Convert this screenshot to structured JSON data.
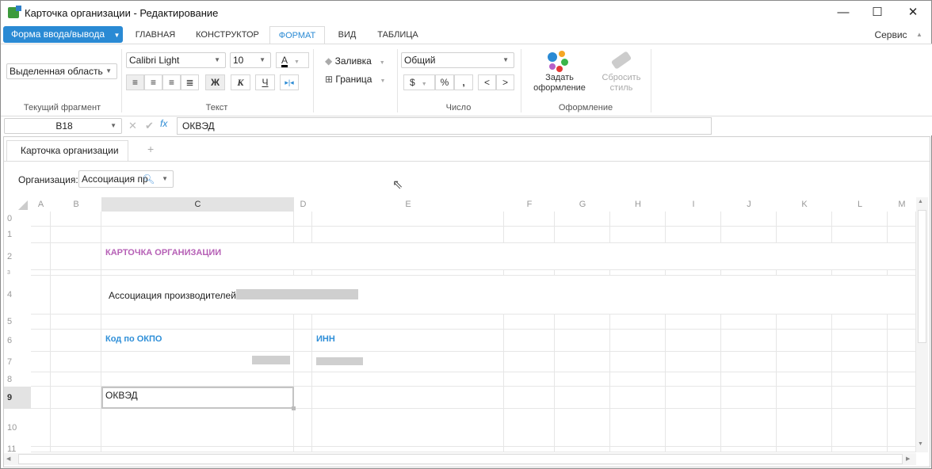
{
  "window": {
    "title": "Карточка организации - Редактирование",
    "controls": {
      "minimize": "—",
      "maximize": "☐",
      "close": "✕"
    }
  },
  "ribbon_tabs": {
    "file": "Форма ввода/вывода",
    "tabs": [
      "ГЛАВНАЯ",
      "КОНСТРУКТОР",
      "ФОРМАТ",
      "ВИД",
      "ТАБЛИЦА"
    ],
    "active": "ФОРМАТ",
    "service": "Сервис"
  },
  "ribbon": {
    "fragment": {
      "select": "Выделенная область",
      "label": "Текущий фрагмент"
    },
    "text": {
      "font": "Calibri Light",
      "size": "10",
      "font_color_glyph": "A",
      "bold": "Ж",
      "italic": "К",
      "underline": "Ч",
      "label": "Текст"
    },
    "fill": {
      "fill": "Заливка",
      "border": "Граница"
    },
    "number": {
      "format": "Общий",
      "currency": "$",
      "percent": "%",
      "comma": ",",
      "dec_less": "<",
      "dec_more": ">",
      "label": "Число"
    },
    "style": {
      "set_line1": "Задать",
      "set_line2": "оформление",
      "reset_line1": "Сбросить",
      "reset_line2": "стиль",
      "label": "Оформление"
    }
  },
  "formula_bar": {
    "cell": "B18",
    "value": "ОКВЭД",
    "cancel": "✕",
    "confirm": "✔"
  },
  "doc_tabs": {
    "tab": "Карточка организации",
    "add": "+"
  },
  "filter": {
    "label": "Организация:",
    "value": "Ассоциация пр"
  },
  "sheet": {
    "columns": [
      "A",
      "B",
      "C",
      "D",
      "E",
      "F",
      "G",
      "H",
      "I",
      "J",
      "K",
      "L",
      "M"
    ],
    "rows": [
      "0",
      "1",
      "2",
      "3",
      "4",
      "5",
      "6",
      "7",
      "8",
      "9",
      "10",
      "11"
    ],
    "selected_row": "9",
    "selected_col": "C",
    "cells": {
      "title": "КАРТОЧКА ОРГАНИЗАЦИИ",
      "org_name": "Ассоциация производителей",
      "okpo_label": "Код по ОКПО",
      "inn_label": "ИНН",
      "okved_label": "ОКВЭД"
    },
    "colors": {
      "title": "#b660b6",
      "label": "#2f8fd8"
    }
  }
}
